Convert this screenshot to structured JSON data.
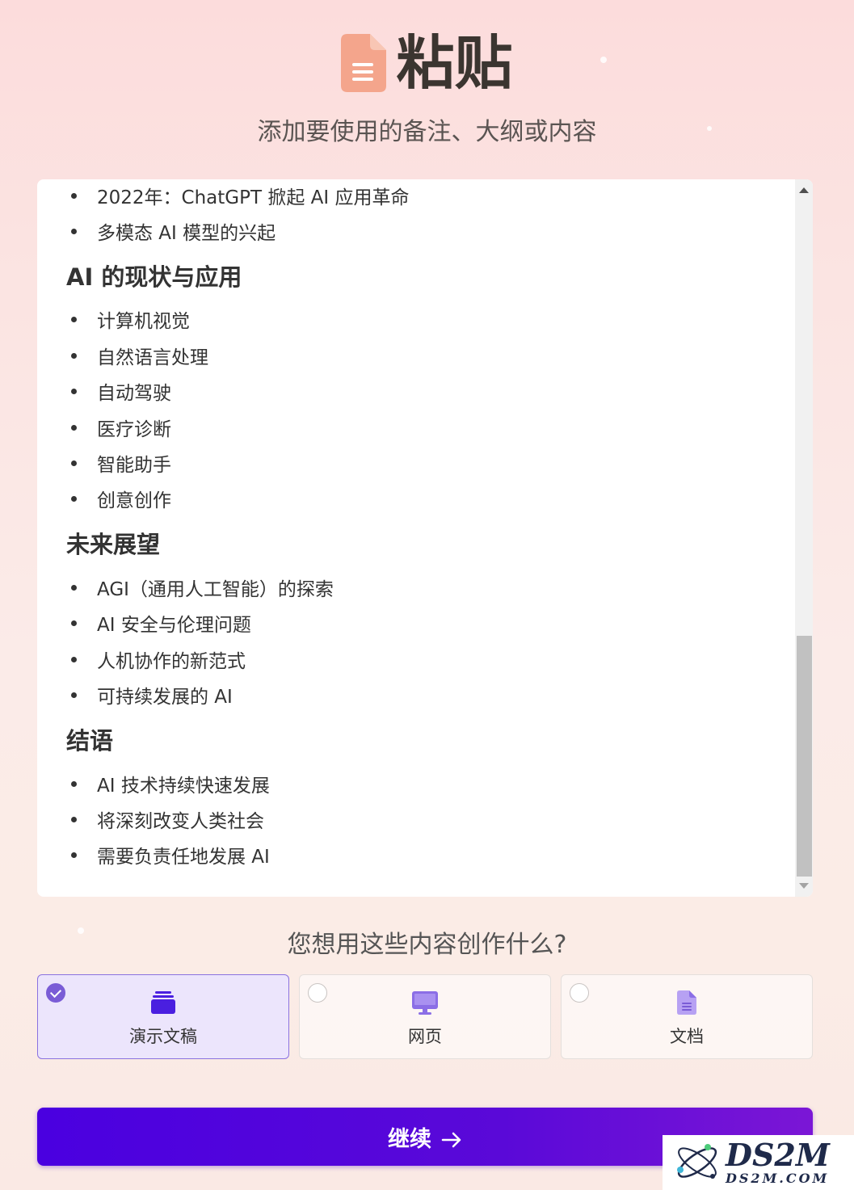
{
  "header": {
    "title": "粘贴",
    "subtitle": "添加要使用的备注、大纲或内容",
    "icon": "document-icon"
  },
  "content": {
    "sections": [
      {
        "type": "bullet",
        "text": "2022年：ChatGPT 掀起 AI 应用革命"
      },
      {
        "type": "bullet",
        "text": "多模态 AI 模型的兴起"
      },
      {
        "type": "heading",
        "text": "AI 的现状与应用"
      },
      {
        "type": "bullet",
        "text": "计算机视觉"
      },
      {
        "type": "bullet",
        "text": "自然语言处理"
      },
      {
        "type": "bullet",
        "text": "自动驾驶"
      },
      {
        "type": "bullet",
        "text": "医疗诊断"
      },
      {
        "type": "bullet",
        "text": "智能助手"
      },
      {
        "type": "bullet",
        "text": "创意创作"
      },
      {
        "type": "heading",
        "text": "未来展望"
      },
      {
        "type": "bullet",
        "text": "AGI（通用人工智能）的探索"
      },
      {
        "type": "bullet",
        "text": "AI 安全与伦理问题"
      },
      {
        "type": "bullet",
        "text": "人机协作的新范式"
      },
      {
        "type": "bullet",
        "text": "可持续发展的 AI"
      },
      {
        "type": "heading",
        "text": "结语"
      },
      {
        "type": "bullet",
        "text": "AI 技术持续快速发展"
      },
      {
        "type": "bullet",
        "text": "将深刻改变人类社会"
      },
      {
        "type": "bullet",
        "text": "需要负责任地发展 AI"
      }
    ]
  },
  "question": "您想用这些内容创作什么?",
  "options": [
    {
      "label": "演示文稿",
      "icon": "presentation-stack-icon",
      "selected": true,
      "color": "#4a1fe0"
    },
    {
      "label": "网页",
      "icon": "monitor-icon",
      "selected": false,
      "color": "#8b6ee6"
    },
    {
      "label": "文档",
      "icon": "document-icon",
      "selected": false,
      "color": "#a48af0"
    }
  ],
  "continue_button": {
    "label": "继续",
    "icon": "arrow-right-icon"
  },
  "watermark": {
    "line1": "DS2M",
    "line2": "DS2M.COM"
  },
  "colors": {
    "accent": "#4a00e0",
    "selected_bg": "#ece5fc",
    "icon_peach": "#f4a58c"
  }
}
